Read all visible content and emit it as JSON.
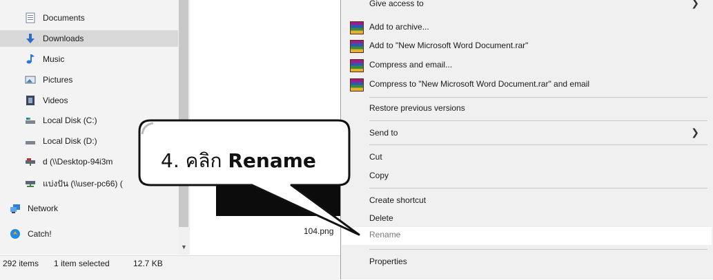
{
  "nav": {
    "items": [
      {
        "label": "Documents",
        "icon": "documents-icon",
        "selected": false
      },
      {
        "label": "Downloads",
        "icon": "downloads-icon",
        "selected": true
      },
      {
        "label": "Music",
        "icon": "music-icon",
        "selected": false
      },
      {
        "label": "Pictures",
        "icon": "pictures-icon",
        "selected": false
      },
      {
        "label": "Videos",
        "icon": "videos-icon",
        "selected": false
      },
      {
        "label": "Local Disk (C:)",
        "icon": "drive-icon",
        "selected": false
      },
      {
        "label": "Local Disk (D:)",
        "icon": "drive-icon",
        "selected": false
      },
      {
        "label": "d (\\\\Desktop-94i3m",
        "icon": "network-drive-icon",
        "selected": false
      },
      {
        "label": "แบ่งปัน (\\\\user-pc66) (",
        "icon": "network-drive-icon",
        "selected": false
      },
      {
        "label": "Network",
        "icon": "network-icon",
        "selected": false
      },
      {
        "label": "Catch!",
        "icon": "catch-icon",
        "selected": false
      }
    ]
  },
  "file": {
    "name": "104.png"
  },
  "status": {
    "items_count": "292 items",
    "selected": "1 item selected",
    "size": "12.7 KB"
  },
  "menu": {
    "give_access": "Give access to",
    "add_archive": "Add to archive...",
    "add_rar": "Add to \"New Microsoft Word Document.rar\"",
    "compress_email": "Compress and email...",
    "compress_rar_email": "Compress to \"New Microsoft Word Document.rar\" and email",
    "restore": "Restore previous versions",
    "send_to": "Send to",
    "cut": "Cut",
    "copy": "Copy",
    "create_shortcut": "Create shortcut",
    "delete": "Delete",
    "rename": "Rename",
    "properties": "Properties"
  },
  "callout": {
    "step": "4. คลิก ",
    "command": "Rename"
  },
  "colors": {
    "menu_bg": "#f0f0f0",
    "nav_bg": "#f3f3f3",
    "selected_bg": "#d9d9d9",
    "hover_bg": "#ffffff"
  }
}
